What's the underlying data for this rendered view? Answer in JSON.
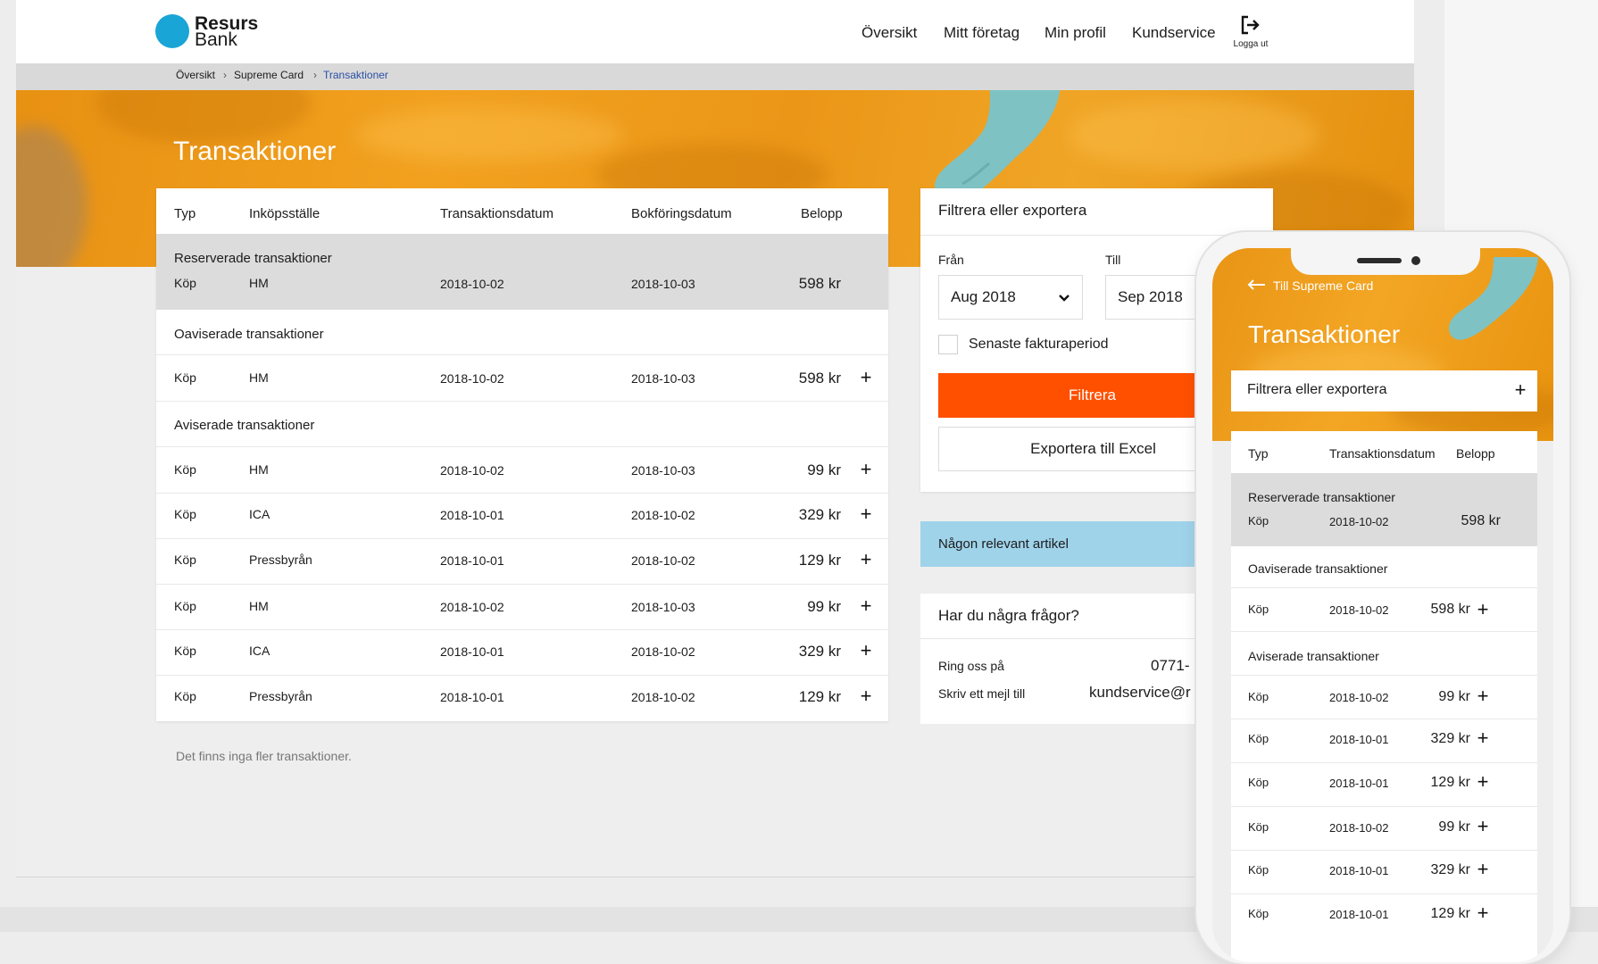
{
  "brand": {
    "name_line1": "Resurs",
    "name_line2": "Bank",
    "accent": "#19a5d6"
  },
  "nav": {
    "items": [
      "Översikt",
      "Mitt företag",
      "Min profil",
      "Kundservice"
    ],
    "logout_label": "Logga ut"
  },
  "breadcrumb": {
    "items": [
      "Översikt",
      "Supreme Card",
      "Transaktioner"
    ],
    "separator": "›"
  },
  "page": {
    "title": "Transaktioner"
  },
  "table": {
    "headers": {
      "type": "Typ",
      "merchant": "Inköpsställe",
      "tdate": "Transaktionsdatum",
      "bdate": "Bokföringsdatum",
      "amount": "Belopp"
    },
    "sections": {
      "reserved": {
        "label": "Reserverade transaktioner",
        "rows": [
          {
            "type": "Köp",
            "merchant": "HM",
            "tdate": "2018-10-02",
            "bdate": "2018-10-03",
            "amount": "598 kr"
          }
        ]
      },
      "unbilled": {
        "label": "Oaviserade transaktioner",
        "rows": [
          {
            "type": "Köp",
            "merchant": "HM",
            "tdate": "2018-10-02",
            "bdate": "2018-10-03",
            "amount": "598 kr"
          }
        ]
      },
      "billed": {
        "label": "Aviserade transaktioner",
        "rows": [
          {
            "type": "Köp",
            "merchant": "HM",
            "tdate": "2018-10-02",
            "bdate": "2018-10-03",
            "amount": "99 kr"
          },
          {
            "type": "Köp",
            "merchant": "ICA",
            "tdate": "2018-10-01",
            "bdate": "2018-10-02",
            "amount": "329 kr"
          },
          {
            "type": "Köp",
            "merchant": "Pressbyrån",
            "tdate": "2018-10-01",
            "bdate": "2018-10-02",
            "amount": "129 kr"
          },
          {
            "type": "Köp",
            "merchant": "HM",
            "tdate": "2018-10-02",
            "bdate": "2018-10-03",
            "amount": "99 kr"
          },
          {
            "type": "Köp",
            "merchant": "ICA",
            "tdate": "2018-10-01",
            "bdate": "2018-10-02",
            "amount": "329 kr"
          },
          {
            "type": "Köp",
            "merchant": "Pressbyrån",
            "tdate": "2018-10-01",
            "bdate": "2018-10-02",
            "amount": "129 kr"
          }
        ]
      }
    },
    "expand_glyph": "+",
    "empty_message": "Det finns inga fler transaktioner."
  },
  "filter": {
    "title": "Filtrera eller exportera",
    "from_label": "Från",
    "from_value": "Aug 2018",
    "to_label": "Till",
    "to_value": "Sep 2018",
    "checkbox_label": "Senaste fakturaperiod",
    "checkbox_checked": false,
    "filter_button": "Filtrera",
    "export_button": "Exportera till Excel",
    "button_color": "#ff5000"
  },
  "article": {
    "label": "Någon relevant artikel",
    "color": "#9fd3ea"
  },
  "questions": {
    "title": "Har du några frågor?",
    "phone_label": "Ring oss på",
    "phone_value": "0771-",
    "email_label": "Skriv ett mejl till",
    "email_value": "kundservice@r"
  },
  "mobile": {
    "back_link": "Till Supreme Card",
    "title": "Transaktioner",
    "filter_title": "Filtrera eller exportera",
    "headers": {
      "type": "Typ",
      "tdate": "Transaktionsdatum",
      "amount": "Belopp"
    },
    "reserved_label": "Reserverade transaktioner",
    "reserved_rows": [
      {
        "type": "Köp",
        "tdate": "2018-10-02",
        "amount": "598 kr"
      }
    ],
    "unbilled_label": "Oaviserade transaktioner",
    "unbilled_rows": [
      {
        "type": "Köp",
        "tdate": "2018-10-02",
        "amount": "598 kr"
      }
    ],
    "billed_label": "Aviserade transaktioner",
    "billed_rows": [
      {
        "type": "Köp",
        "tdate": "2018-10-02",
        "amount": "99 kr"
      },
      {
        "type": "Köp",
        "tdate": "2018-10-01",
        "amount": "329 kr"
      },
      {
        "type": "Köp",
        "tdate": "2018-10-01",
        "amount": "129 kr"
      },
      {
        "type": "Köp",
        "tdate": "2018-10-02",
        "amount": "99 kr"
      },
      {
        "type": "Köp",
        "tdate": "2018-10-01",
        "amount": "329 kr"
      },
      {
        "type": "Köp",
        "tdate": "2018-10-01",
        "amount": "129 kr"
      }
    ]
  }
}
